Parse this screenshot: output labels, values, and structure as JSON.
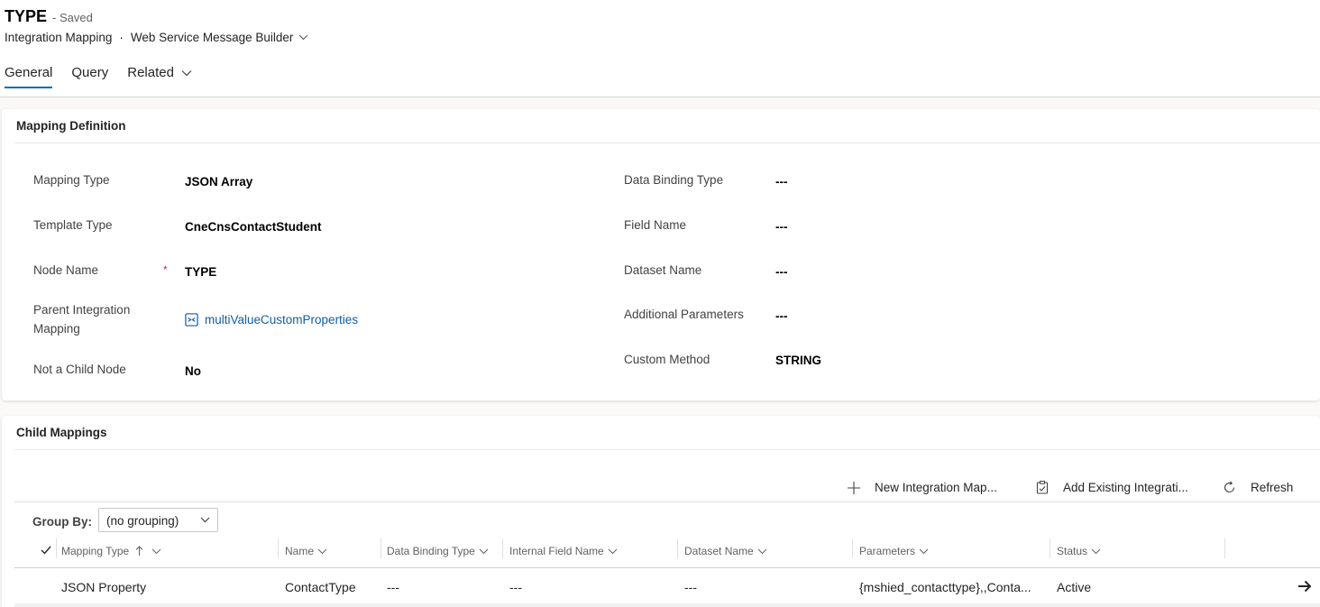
{
  "header": {
    "title": "TYPE",
    "saved": "- Saved",
    "entity": "Integration Mapping",
    "separator": "·",
    "form_name": "Web Service Message Builder"
  },
  "tabs": [
    {
      "label": "General",
      "active": true
    },
    {
      "label": "Query",
      "active": false
    },
    {
      "label": "Related",
      "active": false
    }
  ],
  "mapping_definition": {
    "title": "Mapping Definition",
    "left": [
      {
        "label": "Mapping Type",
        "value": "JSON Array"
      },
      {
        "label": "Template Type",
        "value": "CneCnsContactStudent"
      },
      {
        "label": "Node Name",
        "value": "TYPE",
        "required_mark": "*"
      },
      {
        "label": "Parent Integration Mapping",
        "value": "multiValueCustomProperties"
      },
      {
        "label": "Not a Child Node",
        "value": "No"
      }
    ],
    "right": [
      {
        "label": "Data Binding Type",
        "value": "---"
      },
      {
        "label": "Field Name",
        "value": "---"
      },
      {
        "label": "Dataset Name",
        "value": "---"
      },
      {
        "label": "Additional Parameters",
        "value": "---"
      },
      {
        "label": "Custom Method",
        "value": "STRING"
      }
    ]
  },
  "child_mappings": {
    "title": "Child Mappings",
    "commands": {
      "new": "New Integration Map...",
      "add_existing": "Add Existing Integrati...",
      "refresh": "Refresh"
    },
    "group_by_label": "Group By:",
    "group_by_value": "(no grouping)",
    "columns": [
      "Mapping Type",
      "Name",
      "Data Binding Type",
      "Internal Field Name",
      "Dataset Name",
      "Parameters",
      "Status"
    ],
    "rows": [
      {
        "mapping_type": "JSON Property",
        "name": "ContactType",
        "data_binding_type": "---",
        "internal_field_name": "---",
        "dataset_name": "---",
        "parameters": "{mshied_contacttype},,Conta...",
        "status": "Active"
      }
    ]
  },
  "colors": {
    "accent": "#0f6cbd",
    "link": "#115ea3",
    "required": "#c4314b"
  }
}
